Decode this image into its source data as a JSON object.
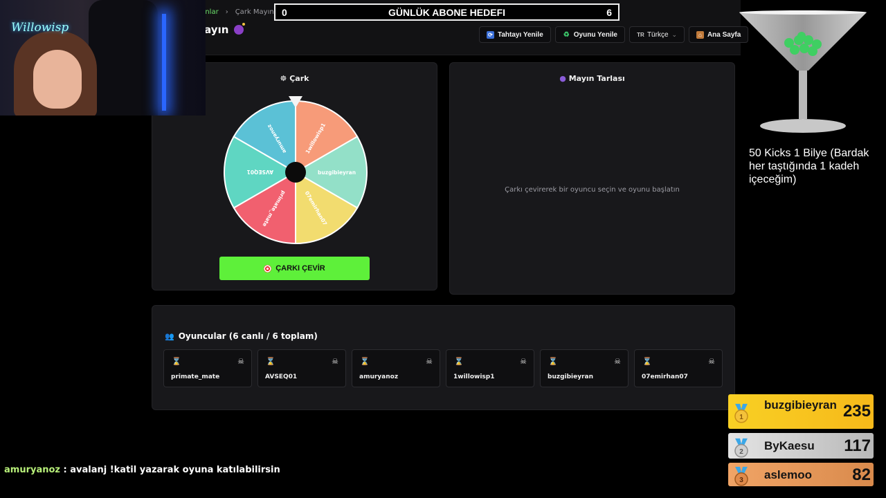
{
  "breadcrumb": {
    "prev": "unlar",
    "current": "Çark Mayın"
  },
  "page": {
    "title": "layın"
  },
  "goal": {
    "title": "GÜNLÜK ABONE HEDEFI",
    "current": "0",
    "target": "6"
  },
  "toolbar": {
    "refresh_board": "Tahtayı Yenile",
    "refresh_game": "Oyunu Yenile",
    "lang_flag": "TR",
    "lang": "Türkçe",
    "home": "Ana Sayfa"
  },
  "wheel": {
    "title": "Çark",
    "spin_label": "ÇARKI ÇEVİR",
    "segments": [
      {
        "label": "1willowisp1",
        "color": "#f79b79"
      },
      {
        "label": "buzgibieyran",
        "color": "#93e0c8"
      },
      {
        "label": "07emirhan07",
        "color": "#f2dc6f"
      },
      {
        "label": "primate_mate",
        "color": "#f1606f"
      },
      {
        "label": "AVSEQ01",
        "color": "#5fd6c2"
      },
      {
        "label": "amuryanoz",
        "color": "#5bc1d6"
      }
    ]
  },
  "minefield": {
    "title": "Mayın Tarlası",
    "message": "Çarkı çevirerek bir oyuncu seçin ve oyunu başlatın"
  },
  "players": {
    "title": "Oyuncular (6 canlı / 6 toplam)",
    "items": [
      {
        "name": "primate_mate"
      },
      {
        "name": "AVSEQ01"
      },
      {
        "name": "amuryanoz"
      },
      {
        "name": "1willowisp1"
      },
      {
        "name": "buzgibieyran"
      },
      {
        "name": "07emirhan07"
      }
    ]
  },
  "overlay": {
    "logo": "Willowisp",
    "kicks_text": "50 Kicks 1 Bilye (Bardak her taştığında 1 kadeh içeceğim)",
    "leaderboard": [
      {
        "rank": "1",
        "name": "buzgibieyran",
        "score": "235"
      },
      {
        "rank": "2",
        "name": "ByKaesu",
        "score": "117"
      },
      {
        "rank": "3",
        "name": "aslemoo",
        "score": "82"
      }
    ],
    "chat": {
      "user": "amuryanoz",
      "message": " : avalanj !katil yazarak oyuna katılabilirsin"
    }
  }
}
